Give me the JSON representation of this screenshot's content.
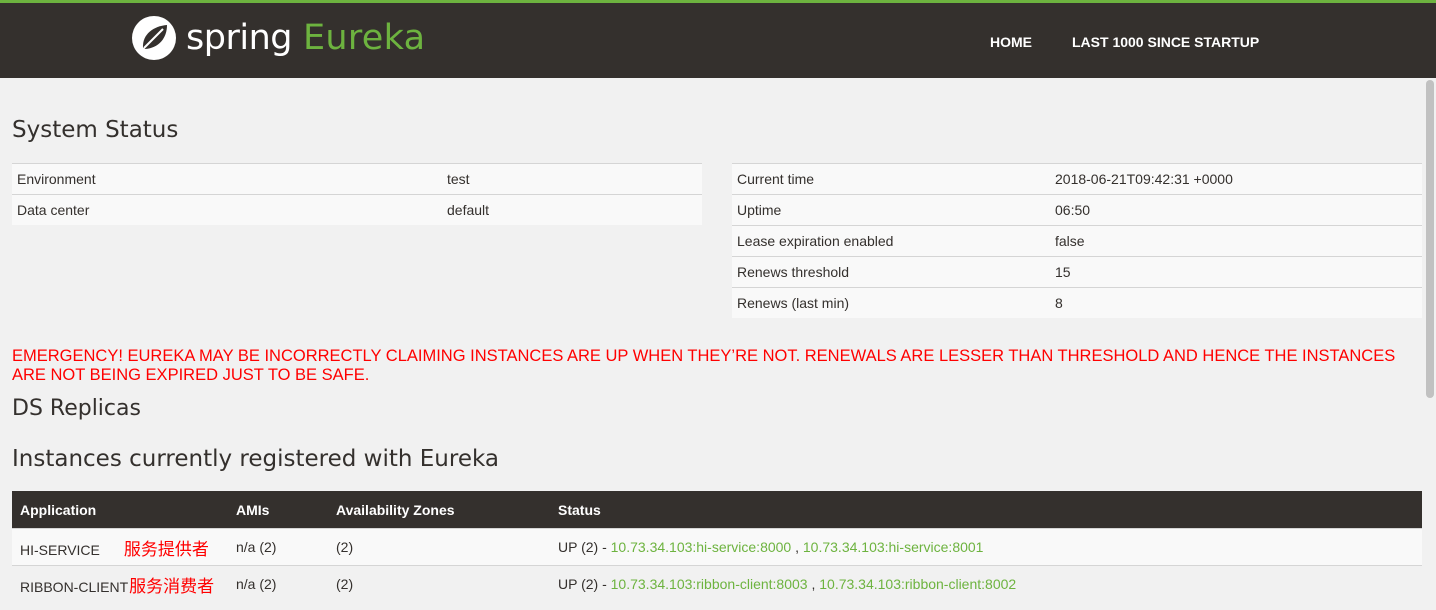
{
  "navbar": {
    "brand_spring": "spring",
    "brand_eureka": "Eureka",
    "links": [
      "HOME",
      "LAST 1000 SINCE STARTUP"
    ]
  },
  "colors": {
    "accent": "#6db33f",
    "navbar_bg": "#34302d",
    "emergency": "#ff0000"
  },
  "system_status": {
    "title": "System Status",
    "left": [
      {
        "label": "Environment",
        "value": "test"
      },
      {
        "label": "Data center",
        "value": "default"
      }
    ],
    "right": [
      {
        "label": "Current time",
        "value": "2018-06-21T09:42:31 +0000"
      },
      {
        "label": "Uptime",
        "value": "06:50"
      },
      {
        "label": "Lease expiration enabled",
        "value": "false"
      },
      {
        "label": "Renews threshold",
        "value": "15"
      },
      {
        "label": "Renews (last min)",
        "value": "8"
      }
    ]
  },
  "emergency": "EMERGENCY! EUREKA MAY BE INCORRECTLY CLAIMING INSTANCES ARE UP WHEN THEY’RE NOT. RENEWALS ARE LESSER THAN THRESHOLD AND HENCE THE INSTANCES ARE NOT BEING EXPIRED JUST TO BE SAFE.",
  "ds_replicas": {
    "title": "DS Replicas"
  },
  "instances": {
    "title": "Instances currently registered with Eureka",
    "headers": [
      "Application",
      "AMIs",
      "Availability Zones",
      "Status"
    ],
    "rows": [
      {
        "application": "HI-SERVICE",
        "note": "服务提供者",
        "amis": "n/a (2)",
        "zones": "(2)",
        "status_prefix": "UP (2) - ",
        "links": [
          "10.73.34.103:hi-service:8000",
          "10.73.34.103:hi-service:8001"
        ],
        "separator": " , "
      },
      {
        "application": "RIBBON-CLIENT",
        "note": "服务消费者",
        "amis": "n/a (2)",
        "zones": "(2)",
        "status_prefix": "UP (2) - ",
        "links": [
          "10.73.34.103:ribbon-client:8003",
          "10.73.34.103:ribbon-client:8002"
        ],
        "separator": " , "
      }
    ]
  }
}
